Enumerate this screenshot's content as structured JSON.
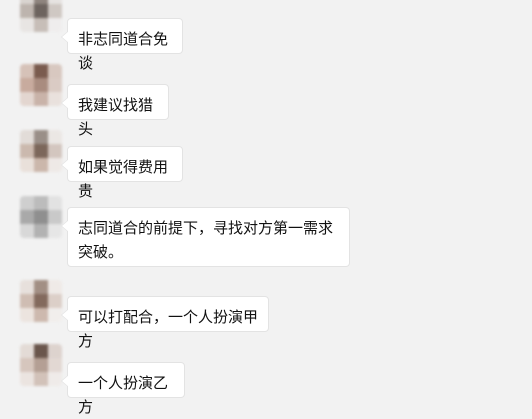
{
  "chat": {
    "messages": [
      {
        "text": "非志同道合免谈"
      },
      {
        "text": "我建议找猎头"
      },
      {
        "text": "如果觉得费用贵"
      },
      {
        "text": "志同道合的前提下，寻找对方第一需求突破。"
      },
      {
        "text": "可以打配合，一个人扮演甲方"
      },
      {
        "text": "一个人扮演乙方"
      }
    ]
  }
}
